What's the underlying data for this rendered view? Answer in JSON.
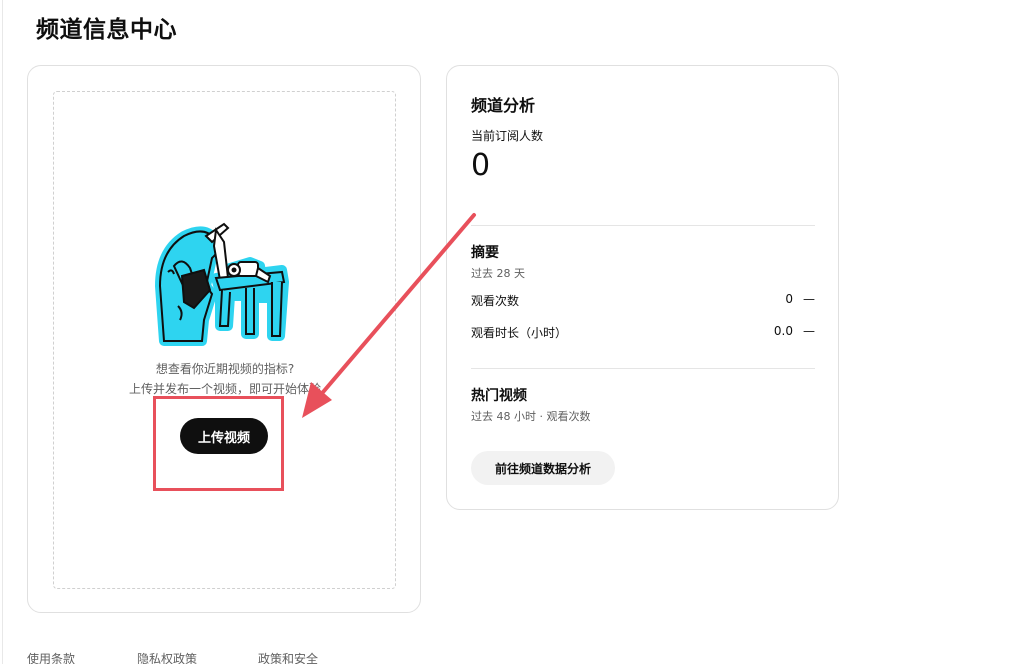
{
  "page": {
    "title": "频道信息中心"
  },
  "upload_card": {
    "prompt_line1": "想查看你近期视频的指标?",
    "prompt_line2": "上传并发布一个视频，即可开始体验",
    "upload_button": "上传视频"
  },
  "analytics": {
    "title": "频道分析",
    "subscribers_label": "当前订阅人数",
    "subscribers_value": "0",
    "summary": {
      "title": "摘要",
      "period": "过去 28 天",
      "rows": [
        {
          "label": "观看次数",
          "value": "0",
          "trend": "—"
        },
        {
          "label": "观看时长（小时）",
          "value": "0.0",
          "trend": "—"
        }
      ]
    },
    "top_videos": {
      "title": "热门视频",
      "period": "过去 48 小时 · 观看次数"
    },
    "goto_button": "前往频道数据分析"
  },
  "footer": {
    "links": [
      "使用条款",
      "隐私权政策",
      "政策和安全"
    ]
  },
  "annotation": {
    "color": "#e8505b"
  },
  "colors": {
    "accent_cyan": "#2ed4f0",
    "button_dark": "#0f0f0f"
  }
}
